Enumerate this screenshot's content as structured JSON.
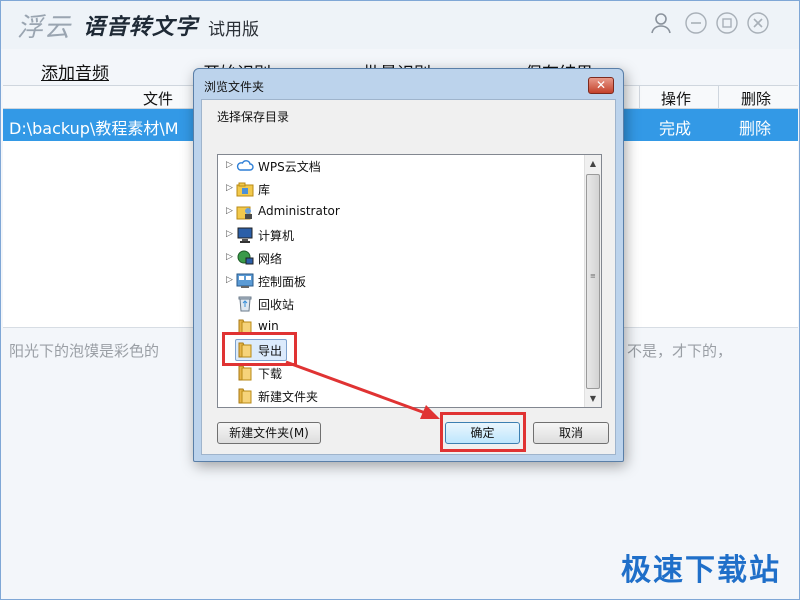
{
  "app": {
    "brand": "浮云",
    "product": "语音转文字",
    "edition": "试用版",
    "menu": [
      "添加音频",
      "开始识别",
      "批量识别",
      "保存结果"
    ],
    "columns": {
      "file": "文件",
      "action": "操作",
      "delete": "删除"
    },
    "row": {
      "file": "D:\\backup\\教程素材\\M",
      "status": "完成",
      "delete": "删除"
    },
    "text_left": "阳光下的泡馍是彩色的",
    "text_right": "不是，才下的，",
    "watermark": "极速下载站"
  },
  "dialog": {
    "title": "浏览文件夹",
    "close": "✕",
    "description": "选择保存目录",
    "tree": [
      {
        "label": "WPS云文档",
        "icon": "cloud-icon",
        "expander": "▷"
      },
      {
        "label": "库",
        "icon": "library-icon",
        "expander": "▷"
      },
      {
        "label": "Administrator",
        "icon": "user-folder-icon",
        "expander": "▷"
      },
      {
        "label": "计算机",
        "icon": "computer-icon",
        "expander": "▷"
      },
      {
        "label": "网络",
        "icon": "network-icon",
        "expander": "▷"
      },
      {
        "label": "控制面板",
        "icon": "control-panel-icon",
        "expander": "▷"
      },
      {
        "label": "回收站",
        "icon": "recycle-bin-icon",
        "expander": ""
      },
      {
        "label": "win",
        "icon": "folder-icon",
        "expander": ""
      },
      {
        "label": "导出",
        "icon": "folder-icon",
        "expander": "",
        "selected": true
      },
      {
        "label": "下载",
        "icon": "folder-icon",
        "expander": ""
      },
      {
        "label": "新建文件夹",
        "icon": "folder-icon",
        "expander": ""
      }
    ],
    "buttons": {
      "new_folder": "新建文件夹(M)",
      "ok": "确定",
      "cancel": "取消"
    }
  },
  "colors": {
    "accent": "#3399e6",
    "highlight": "#e03333",
    "watermark": "#1f6fc9"
  }
}
